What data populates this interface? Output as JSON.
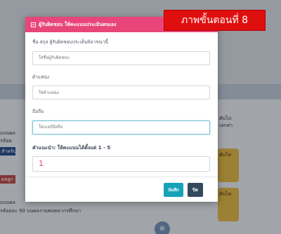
{
  "background": {
    "left_lines": [
      "แบบผล",
      "รห้อย",
      "แบบผล",
      "รห้อยละ 90 บนผลงานพนพจากรศึกษา"
    ],
    "left_chip_1": "สำหรับ",
    "left_chip_2": "ผลลูกค",
    "right_lines": [
      "ตับไป",
      "เอกสา"
    ],
    "right_btn_1": "ดับไห",
    "right_btn_2": "ดับไห",
    "bottom_icon": "⊕"
  },
  "modal": {
    "title": "ผู้รับผิดชอบ ให้คะแนนประเมินตนเอง",
    "fields": [
      {
        "label": "ชื่อ-สกุล ผู้รับผิดชอบประเด็นพิจารณานี้",
        "placeholder": "ใส่ชื่อผู้รับผิดชอบ"
      },
      {
        "label": "ตำแหน่ง",
        "placeholder": "ใส่ตำแหน่ง"
      },
      {
        "label": "มือถือ",
        "placeholder": "ใส่เบอร์มือถือ"
      }
    ],
    "score_label": "คำแนะนำ: ให้คะแนนได้ตั้งแต่ 1 - 5",
    "score_value": "1",
    "save_label": "บันทึก",
    "close_label": "ปิด"
  },
  "step_badge": "ภาพขั้นตอนที่ 8",
  "colors": {
    "header": "#e8467a",
    "save": "#17a2b8",
    "close": "#34495e",
    "badge": "#e00f0f"
  }
}
